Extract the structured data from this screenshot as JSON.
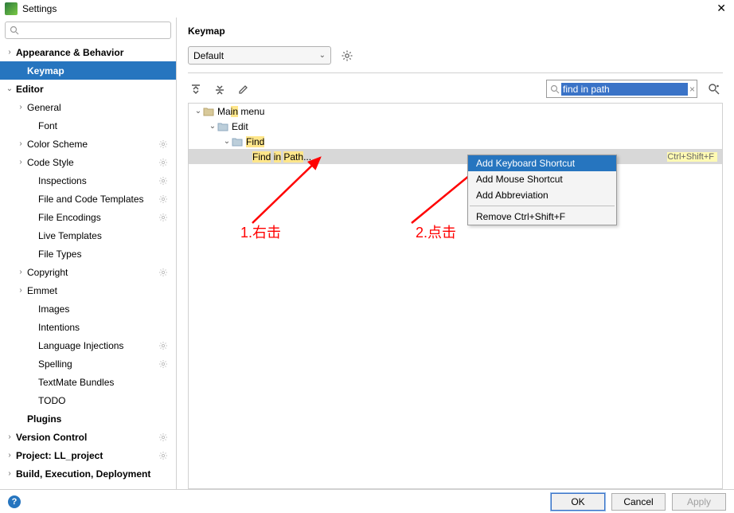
{
  "window": {
    "title": "Settings"
  },
  "sidebar": {
    "search_placeholder": "",
    "items": [
      {
        "label": "Appearance & Behavior",
        "bold": true,
        "chev": "›",
        "indent": 0,
        "gear": false
      },
      {
        "label": "Keymap",
        "bold": true,
        "chev": "",
        "indent": 1,
        "selected": true
      },
      {
        "label": "Editor",
        "bold": true,
        "chev": "⌄",
        "indent": 0
      },
      {
        "label": "General",
        "chev": "›",
        "indent": 1
      },
      {
        "label": "Font",
        "chev": "",
        "indent": 2
      },
      {
        "label": "Color Scheme",
        "chev": "›",
        "indent": 1,
        "gear": true
      },
      {
        "label": "Code Style",
        "chev": "›",
        "indent": 1,
        "gear": true
      },
      {
        "label": "Inspections",
        "chev": "",
        "indent": 2,
        "gear": true
      },
      {
        "label": "File and Code Templates",
        "chev": "",
        "indent": 2,
        "gear": true
      },
      {
        "label": "File Encodings",
        "chev": "",
        "indent": 2,
        "gear": true
      },
      {
        "label": "Live Templates",
        "chev": "",
        "indent": 2
      },
      {
        "label": "File Types",
        "chev": "",
        "indent": 2
      },
      {
        "label": "Copyright",
        "chev": "›",
        "indent": 1,
        "gear": true
      },
      {
        "label": "Emmet",
        "chev": "›",
        "indent": 1
      },
      {
        "label": "Images",
        "chev": "",
        "indent": 2
      },
      {
        "label": "Intentions",
        "chev": "",
        "indent": 2
      },
      {
        "label": "Language Injections",
        "chev": "",
        "indent": 2,
        "gear": true
      },
      {
        "label": "Spelling",
        "chev": "",
        "indent": 2,
        "gear": true
      },
      {
        "label": "TextMate Bundles",
        "chev": "",
        "indent": 2
      },
      {
        "label": "TODO",
        "chev": "",
        "indent": 2
      },
      {
        "label": "Plugins",
        "bold": true,
        "chev": "",
        "indent": 1
      },
      {
        "label": "Version Control",
        "bold": true,
        "chev": "›",
        "indent": 0,
        "gear": true
      },
      {
        "label": "Project: LL_project",
        "bold": true,
        "chev": "›",
        "indent": 0,
        "gear": true
      },
      {
        "label": "Build, Execution, Deployment",
        "bold": true,
        "chev": "›",
        "indent": 0
      }
    ]
  },
  "content": {
    "header": "Keymap",
    "scheme": "Default",
    "search_value": "find in path",
    "tree": {
      "main_menu": "Main menu",
      "edit": "Edit",
      "find": "Find",
      "find_in_path": "Find in Path...",
      "shortcut": "Ctrl+Shift+F"
    }
  },
  "context_menu": {
    "items": [
      {
        "label": "Add Keyboard Shortcut",
        "hover": true
      },
      {
        "label": "Add Mouse Shortcut"
      },
      {
        "label": "Add Abbreviation"
      }
    ],
    "remove": "Remove Ctrl+Shift+F"
  },
  "annotations": {
    "a1": "1.右击",
    "a2": "2.点击"
  },
  "footer": {
    "ok": "OK",
    "cancel": "Cancel",
    "apply": "Apply"
  }
}
